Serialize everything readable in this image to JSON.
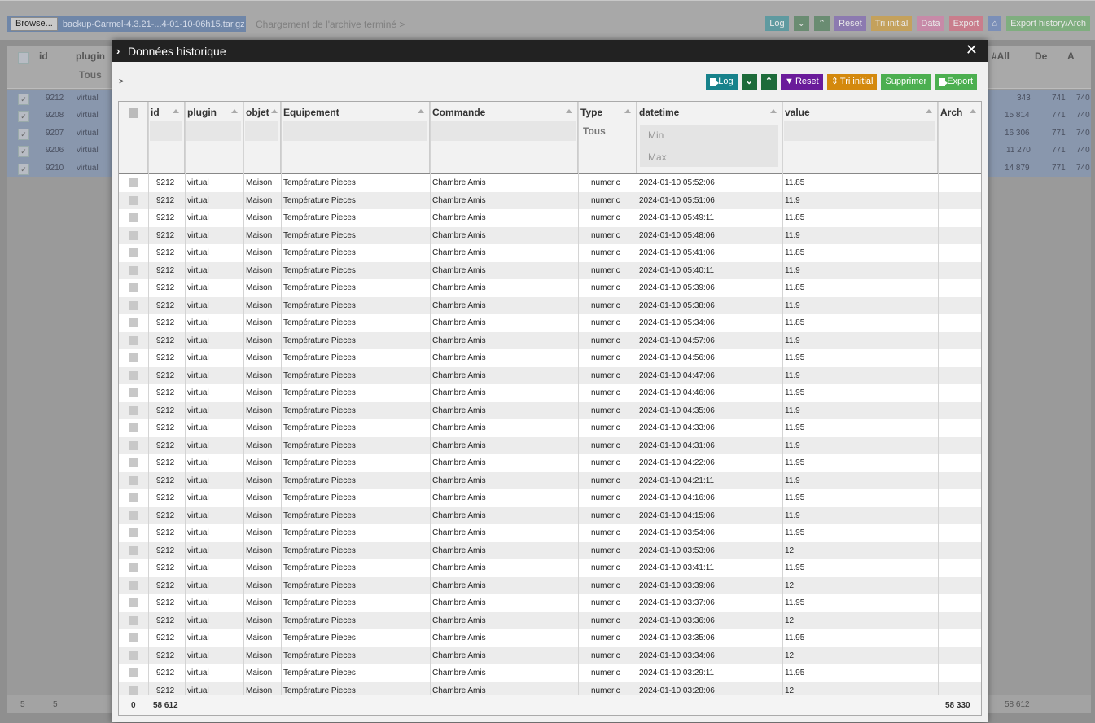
{
  "bg": {
    "browse_label": "Browse...",
    "file_name": "backup-Carmel-4.3.21-...4-01-10-06h15.tar.gz",
    "status": "Chargement de l'archive terminé >",
    "buttons": {
      "log": "Log",
      "reset": "Reset",
      "tri": "Tri initial",
      "data": "Data",
      "export": "Export",
      "export_hist": "Export history/Arch"
    },
    "headers": {
      "id": "id",
      "plugin": "plugin",
      "plugin_filter": "Tous",
      "all": "#All",
      "de": "De",
      "a": "A"
    },
    "rows": [
      {
        "id": "9212",
        "plugin": "virtual",
        "all": "343",
        "de": "741",
        "a": "740"
      },
      {
        "id": "9208",
        "plugin": "virtual",
        "all": "15 814",
        "de": "771",
        "a": "740"
      },
      {
        "id": "9207",
        "plugin": "virtual",
        "all": "16 306",
        "de": "771",
        "a": "740"
      },
      {
        "id": "9206",
        "plugin": "virtual",
        "all": "11 270",
        "de": "771",
        "a": "740"
      },
      {
        "id": "9210",
        "plugin": "virtual",
        "all": "14 879",
        "de": "771",
        "a": "740"
      }
    ],
    "footer": {
      "c1": "5",
      "c2": "5",
      "all": "58 612"
    }
  },
  "modal": {
    "title": "Données historique",
    "breadcrumb": ">",
    "toolbar": {
      "log": "Log",
      "reset": "Reset",
      "tri": "Tri initial",
      "supprimer": "Supprimer",
      "export": "Export"
    },
    "columns": {
      "id": "id",
      "plugin": "plugin",
      "objet": "objet",
      "equipement": "Equipement",
      "commande": "Commande",
      "type": "Type",
      "type_filter": "Tous",
      "datetime": "datetime",
      "min": "Min",
      "max": "Max",
      "value": "value",
      "arch": "Arch"
    },
    "rows": [
      {
        "id": "9212",
        "plugin": "virtual",
        "objet": "Maison",
        "equipement": "Température Pieces",
        "commande": "Chambre Amis",
        "type": "numeric",
        "datetime": "2024-01-10 05:52:06",
        "value": "11.85"
      },
      {
        "id": "9212",
        "plugin": "virtual",
        "objet": "Maison",
        "equipement": "Température Pieces",
        "commande": "Chambre Amis",
        "type": "numeric",
        "datetime": "2024-01-10 05:51:06",
        "value": "11.9"
      },
      {
        "id": "9212",
        "plugin": "virtual",
        "objet": "Maison",
        "equipement": "Température Pieces",
        "commande": "Chambre Amis",
        "type": "numeric",
        "datetime": "2024-01-10 05:49:11",
        "value": "11.85"
      },
      {
        "id": "9212",
        "plugin": "virtual",
        "objet": "Maison",
        "equipement": "Température Pieces",
        "commande": "Chambre Amis",
        "type": "numeric",
        "datetime": "2024-01-10 05:48:06",
        "value": "11.9"
      },
      {
        "id": "9212",
        "plugin": "virtual",
        "objet": "Maison",
        "equipement": "Température Pieces",
        "commande": "Chambre Amis",
        "type": "numeric",
        "datetime": "2024-01-10 05:41:06",
        "value": "11.85"
      },
      {
        "id": "9212",
        "plugin": "virtual",
        "objet": "Maison",
        "equipement": "Température Pieces",
        "commande": "Chambre Amis",
        "type": "numeric",
        "datetime": "2024-01-10 05:40:11",
        "value": "11.9"
      },
      {
        "id": "9212",
        "plugin": "virtual",
        "objet": "Maison",
        "equipement": "Température Pieces",
        "commande": "Chambre Amis",
        "type": "numeric",
        "datetime": "2024-01-10 05:39:06",
        "value": "11.85"
      },
      {
        "id": "9212",
        "plugin": "virtual",
        "objet": "Maison",
        "equipement": "Température Pieces",
        "commande": "Chambre Amis",
        "type": "numeric",
        "datetime": "2024-01-10 05:38:06",
        "value": "11.9"
      },
      {
        "id": "9212",
        "plugin": "virtual",
        "objet": "Maison",
        "equipement": "Température Pieces",
        "commande": "Chambre Amis",
        "type": "numeric",
        "datetime": "2024-01-10 05:34:06",
        "value": "11.85"
      },
      {
        "id": "9212",
        "plugin": "virtual",
        "objet": "Maison",
        "equipement": "Température Pieces",
        "commande": "Chambre Amis",
        "type": "numeric",
        "datetime": "2024-01-10 04:57:06",
        "value": "11.9"
      },
      {
        "id": "9212",
        "plugin": "virtual",
        "objet": "Maison",
        "equipement": "Température Pieces",
        "commande": "Chambre Amis",
        "type": "numeric",
        "datetime": "2024-01-10 04:56:06",
        "value": "11.95"
      },
      {
        "id": "9212",
        "plugin": "virtual",
        "objet": "Maison",
        "equipement": "Température Pieces",
        "commande": "Chambre Amis",
        "type": "numeric",
        "datetime": "2024-01-10 04:47:06",
        "value": "11.9"
      },
      {
        "id": "9212",
        "plugin": "virtual",
        "objet": "Maison",
        "equipement": "Température Pieces",
        "commande": "Chambre Amis",
        "type": "numeric",
        "datetime": "2024-01-10 04:46:06",
        "value": "11.95"
      },
      {
        "id": "9212",
        "plugin": "virtual",
        "objet": "Maison",
        "equipement": "Température Pieces",
        "commande": "Chambre Amis",
        "type": "numeric",
        "datetime": "2024-01-10 04:35:06",
        "value": "11.9"
      },
      {
        "id": "9212",
        "plugin": "virtual",
        "objet": "Maison",
        "equipement": "Température Pieces",
        "commande": "Chambre Amis",
        "type": "numeric",
        "datetime": "2024-01-10 04:33:06",
        "value": "11.95"
      },
      {
        "id": "9212",
        "plugin": "virtual",
        "objet": "Maison",
        "equipement": "Température Pieces",
        "commande": "Chambre Amis",
        "type": "numeric",
        "datetime": "2024-01-10 04:31:06",
        "value": "11.9"
      },
      {
        "id": "9212",
        "plugin": "virtual",
        "objet": "Maison",
        "equipement": "Température Pieces",
        "commande": "Chambre Amis",
        "type": "numeric",
        "datetime": "2024-01-10 04:22:06",
        "value": "11.95"
      },
      {
        "id": "9212",
        "plugin": "virtual",
        "objet": "Maison",
        "equipement": "Température Pieces",
        "commande": "Chambre Amis",
        "type": "numeric",
        "datetime": "2024-01-10 04:21:11",
        "value": "11.9"
      },
      {
        "id": "9212",
        "plugin": "virtual",
        "objet": "Maison",
        "equipement": "Température Pieces",
        "commande": "Chambre Amis",
        "type": "numeric",
        "datetime": "2024-01-10 04:16:06",
        "value": "11.95"
      },
      {
        "id": "9212",
        "plugin": "virtual",
        "objet": "Maison",
        "equipement": "Température Pieces",
        "commande": "Chambre Amis",
        "type": "numeric",
        "datetime": "2024-01-10 04:15:06",
        "value": "11.9"
      },
      {
        "id": "9212",
        "plugin": "virtual",
        "objet": "Maison",
        "equipement": "Température Pieces",
        "commande": "Chambre Amis",
        "type": "numeric",
        "datetime": "2024-01-10 03:54:06",
        "value": "11.95"
      },
      {
        "id": "9212",
        "plugin": "virtual",
        "objet": "Maison",
        "equipement": "Température Pieces",
        "commande": "Chambre Amis",
        "type": "numeric",
        "datetime": "2024-01-10 03:53:06",
        "value": "12"
      },
      {
        "id": "9212",
        "plugin": "virtual",
        "objet": "Maison",
        "equipement": "Température Pieces",
        "commande": "Chambre Amis",
        "type": "numeric",
        "datetime": "2024-01-10 03:41:11",
        "value": "11.95"
      },
      {
        "id": "9212",
        "plugin": "virtual",
        "objet": "Maison",
        "equipement": "Température Pieces",
        "commande": "Chambre Amis",
        "type": "numeric",
        "datetime": "2024-01-10 03:39:06",
        "value": "12"
      },
      {
        "id": "9212",
        "plugin": "virtual",
        "objet": "Maison",
        "equipement": "Température Pieces",
        "commande": "Chambre Amis",
        "type": "numeric",
        "datetime": "2024-01-10 03:37:06",
        "value": "11.95"
      },
      {
        "id": "9212",
        "plugin": "virtual",
        "objet": "Maison",
        "equipement": "Température Pieces",
        "commande": "Chambre Amis",
        "type": "numeric",
        "datetime": "2024-01-10 03:36:06",
        "value": "12"
      },
      {
        "id": "9212",
        "plugin": "virtual",
        "objet": "Maison",
        "equipement": "Température Pieces",
        "commande": "Chambre Amis",
        "type": "numeric",
        "datetime": "2024-01-10 03:35:06",
        "value": "11.95"
      },
      {
        "id": "9212",
        "plugin": "virtual",
        "objet": "Maison",
        "equipement": "Température Pieces",
        "commande": "Chambre Amis",
        "type": "numeric",
        "datetime": "2024-01-10 03:34:06",
        "value": "12"
      },
      {
        "id": "9212",
        "plugin": "virtual",
        "objet": "Maison",
        "equipement": "Température Pieces",
        "commande": "Chambre Amis",
        "type": "numeric",
        "datetime": "2024-01-10 03:29:11",
        "value": "11.95"
      },
      {
        "id": "9212",
        "plugin": "virtual",
        "objet": "Maison",
        "equipement": "Température Pieces",
        "commande": "Chambre Amis",
        "type": "numeric",
        "datetime": "2024-01-10 03:28:06",
        "value": "12"
      }
    ],
    "footer": {
      "chk_count": "0",
      "id_count": "58 612",
      "arch_count": "58 330"
    }
  },
  "colors": {
    "log": "#17828b",
    "chevron": "#1d6b3a",
    "reset": "#6a1b9a",
    "tri": "#d4890d",
    "supprimer": "#4caf50",
    "export": "#4caf50",
    "title_bar": "#222222"
  },
  "icons": [
    "chevron-right-icon",
    "maximize-icon",
    "close-icon",
    "log-icon",
    "chevron-double-down-icon",
    "chevron-double-up-icon",
    "filter-icon",
    "sort-icon",
    "export-icon",
    "home-icon",
    "check-icon"
  ]
}
